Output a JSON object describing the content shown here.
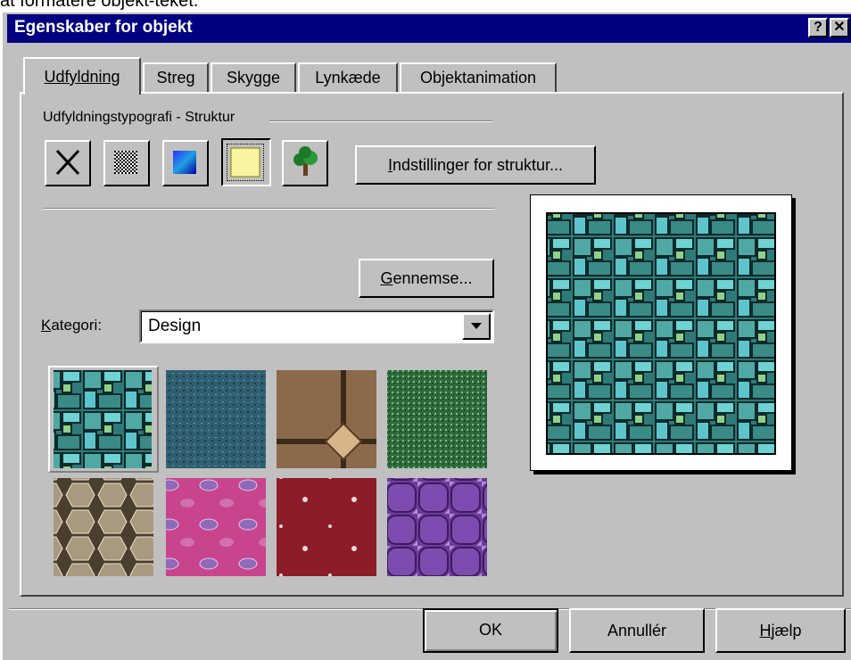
{
  "caption": "at formatere objekt-teket.",
  "window": {
    "title": "Egenskaber for objekt",
    "help_button": "?",
    "close_button": "✕"
  },
  "tabs": [
    {
      "label": "Udfyldning",
      "active": true
    },
    {
      "label": "Streg"
    },
    {
      "label": "Skygge"
    },
    {
      "label": "Lynkæde"
    },
    {
      "label": "Objektanimation"
    }
  ],
  "fill": {
    "group_label": "Udfyldningstypografi - Struktur",
    "types": [
      {
        "name": "no-fill",
        "icon": "x-icon"
      },
      {
        "name": "pattern",
        "icon": "checker-pattern-icon"
      },
      {
        "name": "gradient",
        "icon": "gradient-icon"
      },
      {
        "name": "texture",
        "icon": "texture-icon",
        "selected": true
      },
      {
        "name": "picture",
        "icon": "tree-icon"
      }
    ],
    "settings_button": {
      "pre": "",
      "mnemonic": "I",
      "post": "ndstillinger for struktur..."
    },
    "browse_button": {
      "pre": "",
      "mnemonic": "G",
      "post": "ennemse..."
    },
    "category_label": {
      "mnemonic": "K",
      "post": "ategori:"
    },
    "category_value": "Design"
  },
  "textures": [
    {
      "name": "teal-stone",
      "selected": true,
      "colors": [
        "#3a8a86",
        "#6fd3d3"
      ]
    },
    {
      "name": "blue-granite",
      "colors": [
        "#2f5f70",
        "#3c7d8f"
      ]
    },
    {
      "name": "brown-tiles",
      "colors": [
        "#8a6a4a",
        "#d8b48a"
      ]
    },
    {
      "name": "green-marble",
      "colors": [
        "#2e6a3e",
        "#7fbf7a"
      ]
    },
    {
      "name": "hexagon-stone",
      "colors": [
        "#a89a7e",
        "#4a3e2e"
      ]
    },
    {
      "name": "pink-paisley",
      "colors": [
        "#c8448c",
        "#8e6ab8"
      ]
    },
    {
      "name": "red-figures",
      "colors": [
        "#8c1c28",
        "#f0d8d8"
      ]
    },
    {
      "name": "purple-tiles",
      "colors": [
        "#6c3c9a",
        "#b48ae0"
      ]
    }
  ],
  "footer": {
    "ok": "OK",
    "cancel": "Annullér",
    "help": {
      "mnemonic": "H",
      "post": "jælp"
    }
  }
}
